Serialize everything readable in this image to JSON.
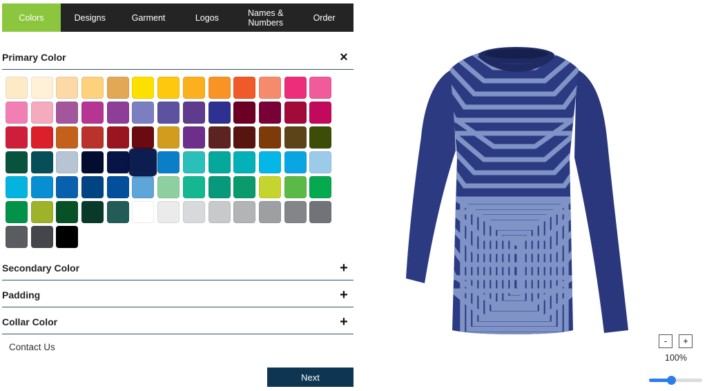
{
  "tabs": [
    {
      "label": "Colors",
      "active": true
    },
    {
      "label": "Designs",
      "active": false
    },
    {
      "label": "Garment",
      "active": false
    },
    {
      "label": "Logos",
      "active": false
    },
    {
      "label": "Names &\nNumbers",
      "active": false
    },
    {
      "label": "Order",
      "active": false
    }
  ],
  "sections": {
    "primary": {
      "title": "Primary Color",
      "toggle": "×"
    },
    "secondary": {
      "title": "Secondary Color",
      "toggle": "+"
    },
    "padding": {
      "title": "Padding",
      "toggle": "+"
    },
    "collar": {
      "title": "Collar Color",
      "toggle": "+"
    }
  },
  "swatches": [
    "#fdebc8",
    "#fef1d8",
    "#fcd9a6",
    "#fdd27c",
    "#e2a855",
    "#fde000",
    "#fec80f",
    "#fdb01f",
    "#f79425",
    "#f05a28",
    "#f68b6b",
    "#ee2d7a",
    "#f05b9b",
    "#f27fb3",
    "#f4abbd",
    "#a3569c",
    "#b63592",
    "#8e3e97",
    "#7b7fc1",
    "#5d52a0",
    "#5f3b8e",
    "#2e3190",
    "#6b0024",
    "#7a0138",
    "#a10b3a",
    "#c3095b",
    "#cf1e3c",
    "#db1f2b",
    "#c3601a",
    "#b9322b",
    "#9b1520",
    "#6c0a11",
    "#d29c1e",
    "#6e2f8c",
    "#5c2320",
    "#571510",
    "#7c3b08",
    "#5c4418",
    "#3b4d06",
    "#07533e",
    "#064f58",
    "#b7c4d4",
    "#020d2f",
    "#081446",
    "#0b1e4f",
    "#0a7fc7",
    "#2bbfb9",
    "#05a99b",
    "#04b1b8",
    "#04b7e7",
    "#0aa6e3",
    "#9bcbe9",
    "#04b4e0",
    "#088fd2",
    "#0961ae",
    "#004581",
    "#034f9c",
    "#5ea5d9",
    "#8ecfa0",
    "#14b890",
    "#06997b",
    "#0a9a6c",
    "#c5d52d",
    "#5bba47",
    "#05a94f",
    "#039249",
    "#9eb22a",
    "#075127",
    "#093a29",
    "#235c57",
    "#ffffff",
    "#eaebea",
    "#d7d9dc",
    "#c7c9cb",
    "#b2b4b6",
    "#9d9fa2",
    "#838589",
    "#717378",
    "#5a5c61",
    "#44464b",
    "#000000"
  ],
  "selected_swatch_index": 44,
  "contact_label": "Contact Us",
  "next_label": "Next",
  "zoom": {
    "minus_label": "-",
    "plus_label": "+",
    "level_text": "100%",
    "slider_fraction": 0.42
  },
  "colors": {
    "accent_green": "#8cc63f",
    "tab_bar": "#242424",
    "next_button": "#0e3552",
    "shirt_body": "#2c3a82",
    "shirt_stripes": "#7f93c6",
    "slider": "#2b7de9"
  },
  "preview": {
    "name": "long-sleeve-shirt-preview"
  }
}
